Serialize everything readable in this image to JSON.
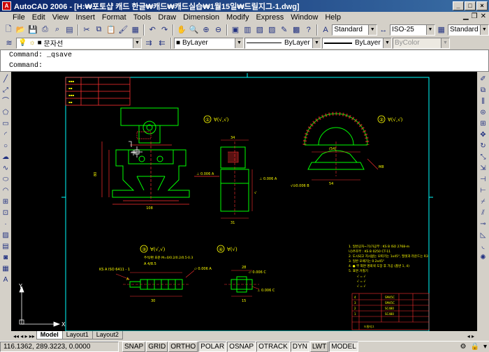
{
  "window": {
    "title": "AutoCAD 2006 - [H:₩포토샵 캐드 한글₩캐드₩캐드실습₩1월15일₩드릴지그-1.dwg]",
    "min_label": "_",
    "max_label": "□",
    "close_label": "×"
  },
  "menu": {
    "items": [
      "File",
      "Edit",
      "View",
      "Insert",
      "Format",
      "Tools",
      "Draw",
      "Dimension",
      "Modify",
      "Express",
      "Window",
      "Help"
    ]
  },
  "toolbar1": {
    "text_style": "Standard",
    "dim_style": "ISO-25",
    "table_style": "Standard"
  },
  "toolbar2": {
    "layer": "문자선",
    "color": "ByLayer",
    "linetype": "ByLayer",
    "lineweight": "ByLayer",
    "plotstyle": "ByColor"
  },
  "command": {
    "history": "Command: _qsave",
    "prompt": "Command:"
  },
  "layout_tabs": [
    "Model",
    "Layout1",
    "Layout2"
  ],
  "status": {
    "coordinates": "116.1362, 289.3223, 0.0000",
    "buttons": [
      "SNAP",
      "GRID",
      "ORTHO",
      "POLAR",
      "OSNAP",
      "OTRACK",
      "DYN",
      "LWT",
      "MODEL"
    ],
    "active": [
      "POLAR",
      "OSNAP",
      "OTRACK",
      "DYN",
      "MODEL"
    ]
  },
  "drawing": {
    "view_labels": [
      "①",
      "②",
      "③",
      "④"
    ],
    "ucs": {
      "x_label": "X",
      "y_label": "Y"
    },
    "colors": {
      "background": "#000000",
      "outline": "#00ffff",
      "part": "#00ff00",
      "dimension": "#ff3030",
      "text": "#ffff00"
    }
  }
}
